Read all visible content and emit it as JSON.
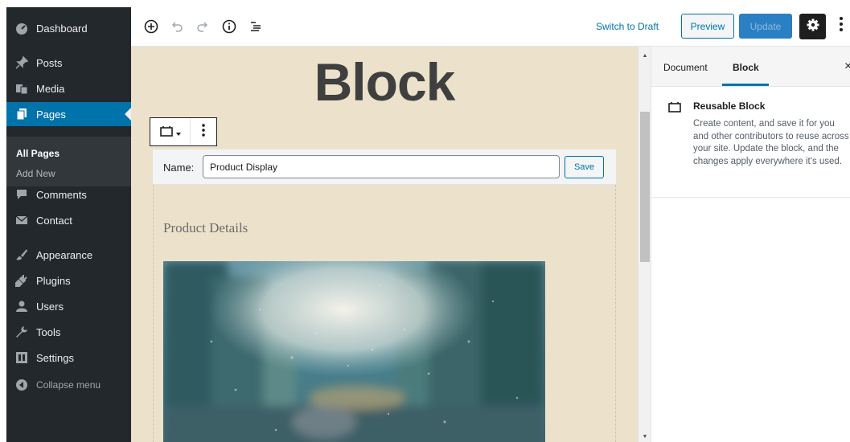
{
  "sidebar": {
    "items": [
      {
        "label": "Dashboard",
        "icon": "dashboard-icon"
      },
      {
        "label": "Posts",
        "icon": "pin-icon"
      },
      {
        "label": "Media",
        "icon": "media-icon"
      },
      {
        "label": "Pages",
        "icon": "pages-icon"
      },
      {
        "label": "Comments",
        "icon": "comments-icon"
      },
      {
        "label": "Contact",
        "icon": "mail-icon"
      },
      {
        "label": "Appearance",
        "icon": "brush-icon"
      },
      {
        "label": "Plugins",
        "icon": "plugin-icon"
      },
      {
        "label": "Users",
        "icon": "users-icon"
      },
      {
        "label": "Tools",
        "icon": "wrench-icon"
      },
      {
        "label": "Settings",
        "icon": "settings-icon"
      }
    ],
    "submenu": {
      "all_pages": "All Pages",
      "add_new": "Add New"
    },
    "collapse": "Collapse menu",
    "active_color": "#0073aa"
  },
  "toolbar": {
    "switch_to_draft": "Switch to Draft",
    "preview": "Preview",
    "update": "Update",
    "icons": [
      "add-block-icon",
      "undo-icon",
      "redo-icon",
      "info-icon",
      "outline-icon",
      "gear-icon",
      "more-vertical-icon"
    ]
  },
  "editor": {
    "title": "Block",
    "reusable": {
      "name_label": "Name:",
      "name_value": "Product Display",
      "save": "Save"
    },
    "product_heading": "Product Details"
  },
  "settings_panel": {
    "tabs": [
      "Document",
      "Block"
    ],
    "active_tab": "Block",
    "close": "×",
    "block_title": "Reusable Block",
    "block_description": "Create content, and save it for you and other contributors to reuse across your site. Update the block, and the changes apply everywhere it's used."
  }
}
